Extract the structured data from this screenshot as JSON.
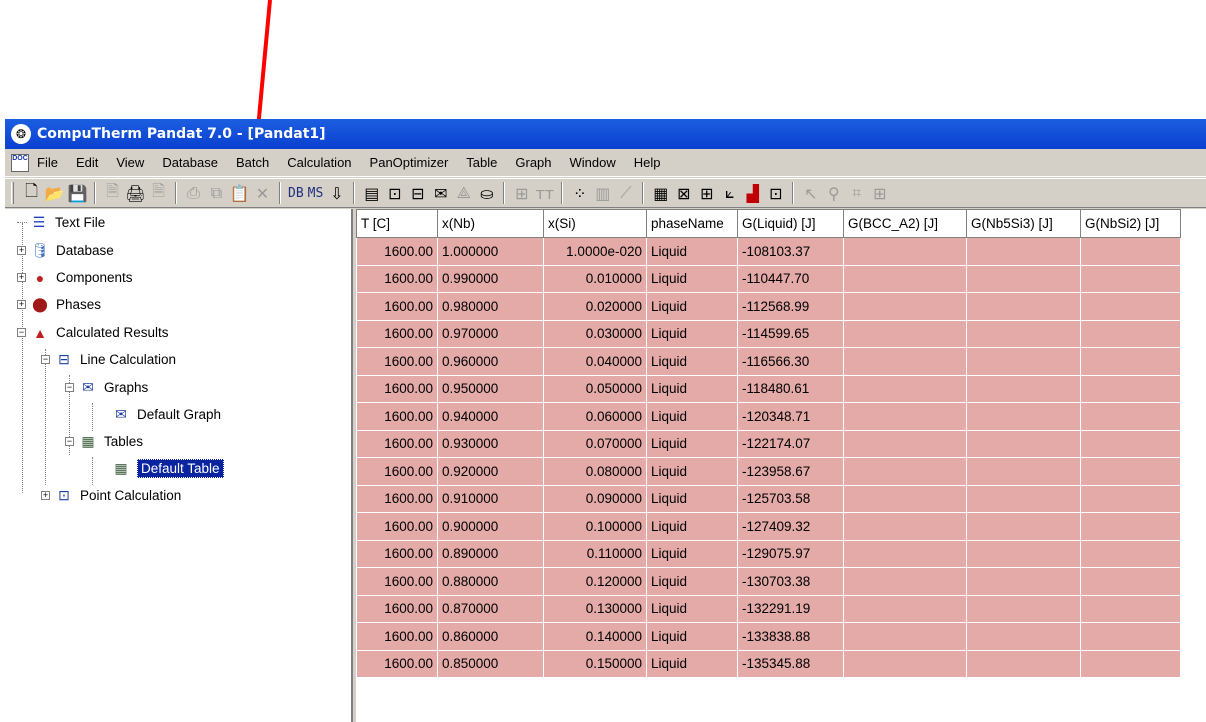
{
  "window": {
    "title": "CompuTherm Pandat 7.0 - [Pandat1]",
    "app_icon": "pandat-app-icon"
  },
  "menu": [
    {
      "label": "File"
    },
    {
      "label": "Edit"
    },
    {
      "label": "View"
    },
    {
      "label": "Database"
    },
    {
      "label": "Batch"
    },
    {
      "label": "Calculation"
    },
    {
      "label": "PanOptimizer"
    },
    {
      "label": "Table"
    },
    {
      "label": "Graph"
    },
    {
      "label": "Window"
    },
    {
      "label": "Help"
    }
  ],
  "toolbar": {
    "db_label": "DB",
    "ms_label": "MS"
  },
  "tree": {
    "text_file": "Text File",
    "database": "Database",
    "components": "Components",
    "phases": "Phases",
    "calculated_results": "Calculated Results",
    "line_calculation": "Line Calculation",
    "graphs": "Graphs",
    "default_graph": "Default Graph",
    "tables": "Tables",
    "default_table": "Default Table",
    "point_calculation": "Point Calculation"
  },
  "table": {
    "headers": [
      "T [C]",
      "x(Nb)",
      "x(Si)",
      "phaseName",
      "G(Liquid) [J]",
      "G(BCC_A2) [J]",
      "G(Nb5Si3) [J]",
      "G(NbSi2) [J]"
    ],
    "rows": [
      [
        "1600.00",
        "1.000000",
        "1.0000e-020",
        "Liquid",
        "-108103.37"
      ],
      [
        "1600.00",
        "0.990000",
        "0.010000",
        "Liquid",
        "-110447.70"
      ],
      [
        "1600.00",
        "0.980000",
        "0.020000",
        "Liquid",
        "-112568.99"
      ],
      [
        "1600.00",
        "0.970000",
        "0.030000",
        "Liquid",
        "-114599.65"
      ],
      [
        "1600.00",
        "0.960000",
        "0.040000",
        "Liquid",
        "-116566.30"
      ],
      [
        "1600.00",
        "0.950000",
        "0.050000",
        "Liquid",
        "-118480.61"
      ],
      [
        "1600.00",
        "0.940000",
        "0.060000",
        "Liquid",
        "-120348.71"
      ],
      [
        "1600.00",
        "0.930000",
        "0.070000",
        "Liquid",
        "-122174.07"
      ],
      [
        "1600.00",
        "0.920000",
        "0.080000",
        "Liquid",
        "-123958.67"
      ],
      [
        "1600.00",
        "0.910000",
        "0.090000",
        "Liquid",
        "-125703.58"
      ],
      [
        "1600.00",
        "0.900000",
        "0.100000",
        "Liquid",
        "-127409.32"
      ],
      [
        "1600.00",
        "0.890000",
        "0.110000",
        "Liquid",
        "-129075.97"
      ],
      [
        "1600.00",
        "0.880000",
        "0.120000",
        "Liquid",
        "-130703.38"
      ],
      [
        "1600.00",
        "0.870000",
        "0.130000",
        "Liquid",
        "-132291.19"
      ],
      [
        "1600.00",
        "0.860000",
        "0.140000",
        "Liquid",
        "-133838.88"
      ],
      [
        "1600.00",
        "0.850000",
        "0.150000",
        "Liquid",
        "-135345.88"
      ]
    ]
  },
  "colors": {
    "title_bar": "#0a3fd0",
    "cell_fill": "#e3aaa7",
    "selection": "#0a24a0",
    "annotation_arrow": "#ff0000"
  }
}
